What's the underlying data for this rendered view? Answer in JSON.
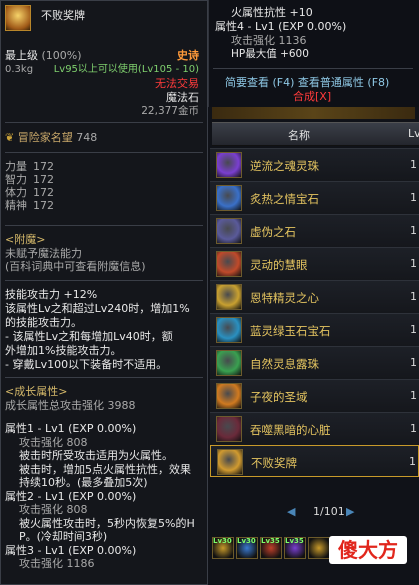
{
  "tooltip": {
    "item_name": "不败奖牌",
    "grade": "最上级",
    "grade_pct": "(100%)",
    "rarity": "史诗",
    "weight": "0.3kg",
    "level_req": "Lv95以上可以使用(Lv105 - 10)",
    "trade": "无法交易",
    "type": "魔法石",
    "price": "22,377金币",
    "adventurer_fame_label": "冒险家名望",
    "adventurer_fame_value": "748",
    "stats": [
      {
        "label": "力量",
        "value": "172"
      },
      {
        "label": "智力",
        "value": "172"
      },
      {
        "label": "体力",
        "value": "172"
      },
      {
        "label": "精神",
        "value": "172"
      }
    ],
    "enchant_title": "<附魔>",
    "enchant_line1": "未赋予魔法能力",
    "enchant_line2": "(百科词典中可查看附魔信息)",
    "skill_lines": [
      "技能攻击力 +12%",
      "该属性Lv之和超过Lv240时，增加1%",
      "的技能攻击力。",
      "- 该属性Lv之和每增加Lv40时，额",
      "外增加1%技能攻击力。",
      "- 穿戴Lv100以下装备时不适用。"
    ],
    "growth_title": "<成长属性>",
    "growth_total": "成长属性总攻击强化  3988",
    "growth_lines": [
      {
        "text": "属性1 - Lv1 (EXP 0.00%)",
        "cls": "white"
      },
      {
        "text": "攻击强化 808",
        "cls": "grey",
        "indent": true
      },
      {
        "text": "被击时所受攻击适用为火属性。",
        "cls": "white",
        "indent": true
      },
      {
        "text": "被击时，增加5点火属性抗性，效果",
        "cls": "white",
        "indent": true
      },
      {
        "text": "持续10秒。(最多叠加5次)",
        "cls": "white",
        "indent": true
      },
      {
        "text": "属性2 - Lv1 (EXP 0.00%)",
        "cls": "white"
      },
      {
        "text": "攻击强化 808",
        "cls": "grey",
        "indent": true
      },
      {
        "text": "被火属性攻击时，5秒内恢复5%的H",
        "cls": "white",
        "indent": true
      },
      {
        "text": "P。(冷却时间3秒)",
        "cls": "white",
        "indent": true
      },
      {
        "text": "属性3 - Lv1 (EXP 0.00%)",
        "cls": "white"
      },
      {
        "text": "攻击强化 1186",
        "cls": "grey",
        "indent": true
      }
    ]
  },
  "right_tooltip": {
    "line1": "火属性抗性 +10",
    "line2": "属性4 - Lv1 (EXP 0.00%)",
    "line3": "攻击强化 1136",
    "line4": "HP最大值 +600",
    "brief_view": "简要查看 (F4)",
    "normal_attr": "查看普通属性 (F8)",
    "synthesis": "合成[X]"
  },
  "list": {
    "header_name": "名称",
    "header_level": "Lv",
    "rows": [
      {
        "name": "逆流之魂灵珠",
        "level": "1",
        "icon_color": "#7a3fd0"
      },
      {
        "name": "炙热之情宝石",
        "level": "1",
        "icon_color": "#3a70c8"
      },
      {
        "name": "虚伪之石",
        "level": "1",
        "icon_color": "#5a5a9a"
      },
      {
        "name": "灵动的慧眼",
        "level": "1",
        "icon_color": "#c04a2a"
      },
      {
        "name": "恩特精灵之心",
        "level": "1",
        "icon_color": "#c8a030"
      },
      {
        "name": "蓝灵绿玉石宝石",
        "level": "1",
        "icon_color": "#2a90c0"
      },
      {
        "name": "自然灵息露珠",
        "level": "1",
        "icon_color": "#3aa050"
      },
      {
        "name": "子夜的圣域",
        "level": "1",
        "icon_color": "#d07a20"
      },
      {
        "name": "吞噬黑暗的心脏",
        "level": "1",
        "icon_color": "#6a2a3a"
      },
      {
        "name": "不败奖牌",
        "level": "1",
        "icon_color": "#d09a30",
        "selected": true
      }
    ],
    "pagination": "1/101",
    "prev_icon": "triangle-left-icon",
    "next_icon": "triangle-right-icon"
  },
  "bottom_slots": {
    "labels": [
      "Lv30",
      "Lv30",
      "Lv35",
      "Lv35"
    ]
  },
  "watermark": "傻大方"
}
